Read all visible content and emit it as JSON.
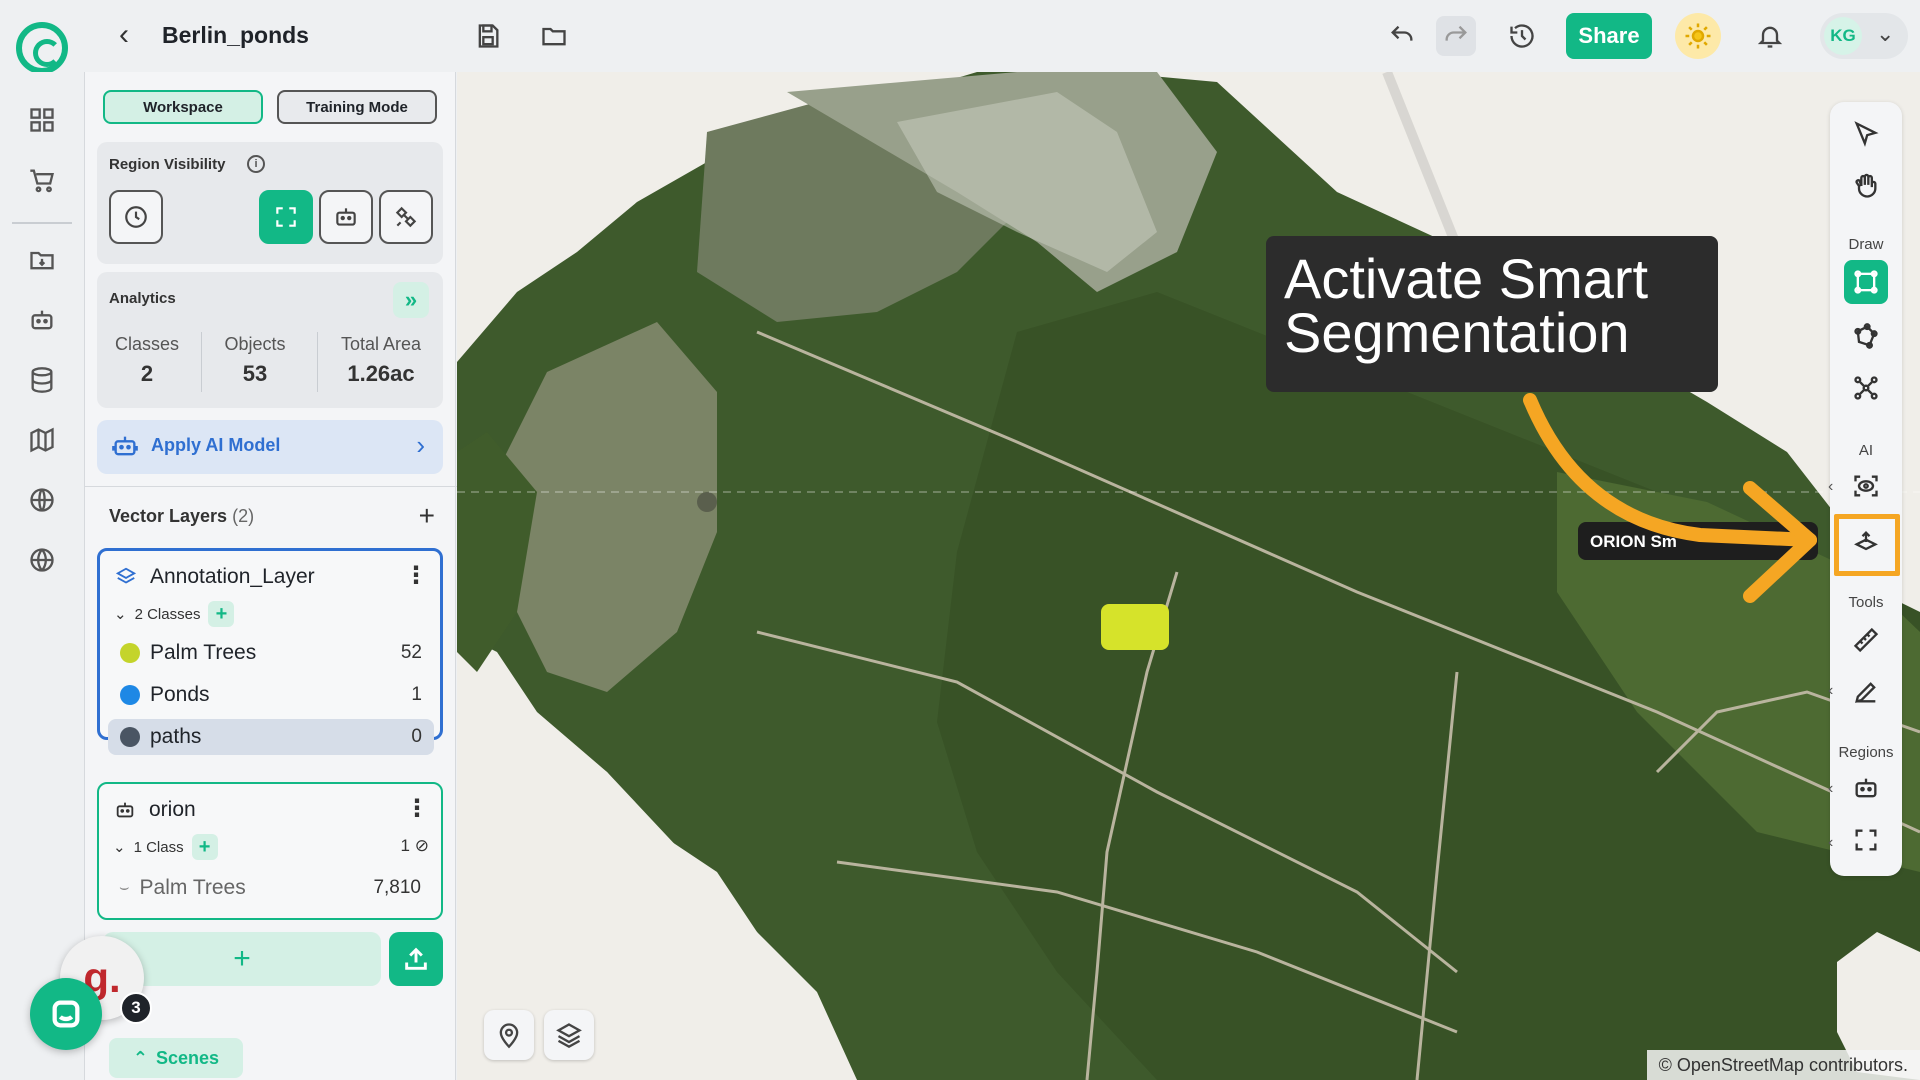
{
  "header": {
    "project_title": "Berlin_ponds",
    "share_label": "Share",
    "avatar_initials": "KG",
    "icons": [
      "back-icon",
      "save-icon",
      "folder-icon",
      "undo-icon",
      "redo-icon",
      "history-icon",
      "sun-icon",
      "bell-icon",
      "chevron-down-icon"
    ]
  },
  "rail": {
    "icons": [
      "dashboard-icon",
      "cart-icon",
      "folder-import-icon",
      "robot-icon",
      "database-icon",
      "map-icon",
      "globe-grid-icon",
      "globe-icon"
    ]
  },
  "panel": {
    "modes": {
      "workspace": "Workspace",
      "training": "Training Mode"
    },
    "region_visibility": {
      "title": "Region Visibility"
    },
    "analytics": {
      "title": "Analytics",
      "classes_label": "Classes",
      "classes_value": "2",
      "objects_label": "Objects",
      "objects_value": "53",
      "area_label": "Total Area",
      "area_value": "1.26ac"
    },
    "apply_ai_label": "Apply AI Model",
    "vector_layers": {
      "title": "Vector Layers",
      "count": "(2)",
      "layers": [
        {
          "name": "Annotation_Layer",
          "classes_label": "2 Classes",
          "classes": [
            {
              "name": "Palm Trees",
              "count": "52",
              "color": "#c4d42b"
            },
            {
              "name": "Ponds",
              "count": "1",
              "color": "#1e88e5"
            },
            {
              "name": "paths",
              "count": "0",
              "color": "#4a5563"
            }
          ]
        },
        {
          "name": "orion",
          "classes_label": "1 Class",
          "hidden_count": "1",
          "classes": [
            {
              "name": "Palm Trees",
              "count": "7,810"
            }
          ]
        }
      ]
    },
    "scenes_label": "Scenes"
  },
  "chat": {
    "badge": "3",
    "g_letter": "g."
  },
  "map": {
    "attribution": "© OpenStreetMap contributors.",
    "callout_text": "Activate Smart Segmentation",
    "orion_tip": "ORION Sm"
  },
  "toolbar": {
    "draw_label": "Draw",
    "ai_label": "AI",
    "tools_label": "Tools",
    "regions_label": "Regions"
  },
  "colors": {
    "accent": "#12b886",
    "highlight": "#f5a623",
    "selected_layer": "#2f6fd1"
  }
}
